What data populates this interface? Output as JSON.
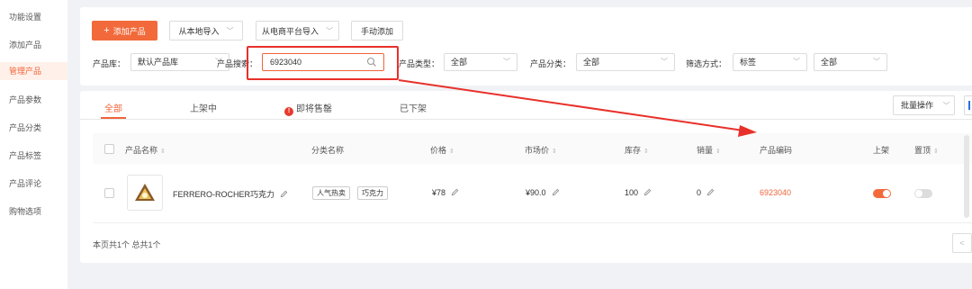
{
  "sidebar": {
    "items": [
      {
        "label": "功能设置"
      },
      {
        "label": "添加产品"
      },
      {
        "label": "管理产品"
      },
      {
        "label": "产品参数"
      },
      {
        "label": "产品分类"
      },
      {
        "label": "产品标签"
      },
      {
        "label": "产品评论"
      },
      {
        "label": "购物选项"
      }
    ],
    "active_index": 2
  },
  "toolbar": {
    "add_label": "添加产品",
    "add_icon": "plus-icon",
    "import_local_label": "从本地导入",
    "import_ecommerce_label": "从电商平台导入",
    "manual_add_label": "手动添加"
  },
  "filters": {
    "library_label": "产品库：",
    "library_value": "默认产品库",
    "search_label": "产品搜索：",
    "search_value": "6923040",
    "type_label": "产品类型：",
    "type_value": "全部",
    "category_label": "产品分类：",
    "category_value": "全部",
    "filter_method_label": "筛选方式：",
    "filter_method_value": "标签",
    "filter_value": "全部"
  },
  "tabs": [
    {
      "label": "全部",
      "active": true
    },
    {
      "label": "上架中"
    },
    {
      "label": "即将售罄",
      "icon": "warning-icon"
    },
    {
      "label": "已下架"
    }
  ],
  "batch_label": "批量操作",
  "table": {
    "headers": {
      "name": "产品名称",
      "category": "分类名称",
      "price": "价格",
      "market_price": "市场价",
      "stock": "库存",
      "sales": "销量",
      "code": "产品编码",
      "listed": "上架",
      "pinned": "置顶"
    },
    "rows": [
      {
        "name": "FERRERO-ROCHER巧克力",
        "tags": [
          "人气热卖",
          "巧克力"
        ],
        "price": "¥78",
        "market_price": "¥90.0",
        "stock": "100",
        "sales": "0",
        "code": "6923040",
        "listed": true,
        "pinned": false
      }
    ]
  },
  "footer": {
    "summary": "本页共1个 总共1个",
    "prev": "<"
  },
  "colors": {
    "accent": "#f26a3b",
    "annotation": "#e8302a"
  }
}
